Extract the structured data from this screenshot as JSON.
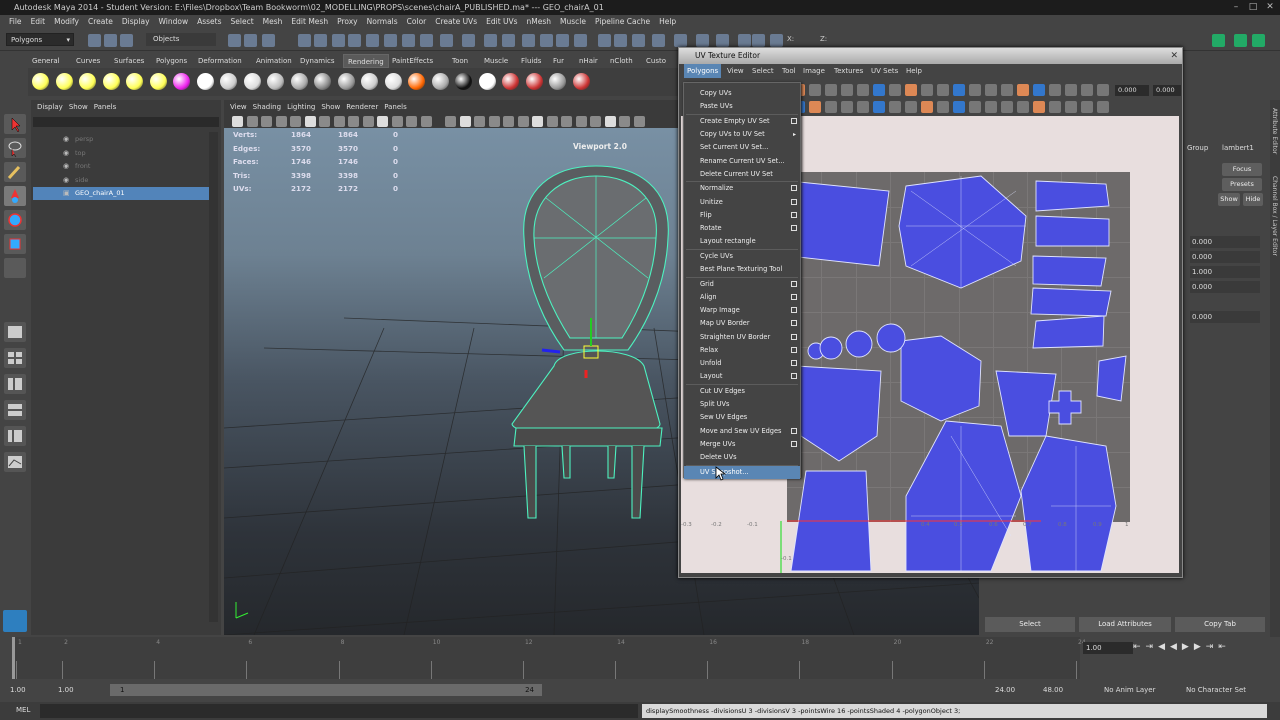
{
  "window": {
    "title": "Autodesk Maya 2014 - Student Version: E:\\Files\\Dropbox\\Team Bookworm\\02_MODELLING\\PROPS\\scenes\\chairA_PUBLISHED.ma*  ---  GEO_chairA_01"
  },
  "menu_bar": [
    "File",
    "Edit",
    "Modify",
    "Create",
    "Display",
    "Window",
    "Assets",
    "Select",
    "Mesh",
    "Edit Mesh",
    "Proxy",
    "Normals",
    "Color",
    "Create UVs",
    "Edit UVs",
    "nMesh",
    "Muscle",
    "Pipeline Cache",
    "Help"
  ],
  "status_line": {
    "mode": "Polygons",
    "objects_label": "Objects",
    "x_label": "X:",
    "y_label": "Y:",
    "z_label": "Z:"
  },
  "shelf": {
    "tabs": [
      "General",
      "Curves",
      "Surfaces",
      "Polygons",
      "Deformation",
      "Animation",
      "Dynamics",
      "Rendering",
      "PaintEffects",
      "Toon",
      "Muscle",
      "Fluids",
      "Fur",
      "nHair",
      "nCloth",
      "Custo"
    ],
    "active_tab": "Rendering"
  },
  "outliner": {
    "menu": [
      "Display",
      "Show",
      "Panels"
    ],
    "items": [
      "persp",
      "top",
      "front",
      "side",
      "GEO_chairA_01"
    ],
    "selected": "GEO_chairA_01"
  },
  "viewport": {
    "menu": [
      "View",
      "Shading",
      "Lighting",
      "Show",
      "Renderer",
      "Panels"
    ],
    "name": "Viewport 2.0",
    "hud": [
      {
        "label": "Verts:",
        "v1": "1864",
        "v2": "1864",
        "v3": "0"
      },
      {
        "label": "Edges:",
        "v1": "3570",
        "v2": "3570",
        "v3": "0"
      },
      {
        "label": "Faces:",
        "v1": "1746",
        "v2": "1746",
        "v3": "0"
      },
      {
        "label": "Tris:",
        "v1": "3398",
        "v2": "3398",
        "v3": "0"
      },
      {
        "label": "UVs:",
        "v1": "2172",
        "v2": "2172",
        "v3": "0"
      }
    ]
  },
  "uv_editor": {
    "title": "UV Texture Editor",
    "menu": [
      "Polygons",
      "View",
      "Select",
      "Tool",
      "Image",
      "Textures",
      "UV Sets",
      "Help"
    ],
    "active_menu": "Polygons",
    "field1": "0.000",
    "field2": "0.000",
    "axis_labels": [
      "-0.3",
      "-0.2",
      "-0.1",
      "0.4",
      "0.5",
      "0.6",
      "0.7",
      "0.8",
      "0.9",
      "1"
    ],
    "tick_bottom": "-0.1"
  },
  "dropdown": {
    "items": [
      {
        "label": "Copy UVs",
        "box": false
      },
      {
        "label": "Paste UVs",
        "box": false
      },
      {
        "label": "Create Empty UV Set",
        "box": true
      },
      {
        "label": "Copy UVs to UV Set",
        "arrow": true
      },
      {
        "label": "Set Current UV Set...",
        "box": false
      },
      {
        "label": "Rename Current UV Set...",
        "box": false
      },
      {
        "label": "Delete Current UV Set",
        "box": false
      },
      {
        "label": "Normalize",
        "box": true
      },
      {
        "label": "Unitize",
        "box": true
      },
      {
        "label": "Flip",
        "box": true
      },
      {
        "label": "Rotate",
        "box": true
      },
      {
        "label": "Layout rectangle",
        "box": false
      },
      {
        "label": "Cycle UVs",
        "box": false
      },
      {
        "label": "Best Plane Texturing Tool",
        "box": false
      },
      {
        "label": "Grid",
        "box": true
      },
      {
        "label": "Align",
        "box": true
      },
      {
        "label": "Warp Image",
        "box": true
      },
      {
        "label": "Map UV Border",
        "box": true
      },
      {
        "label": "Straighten UV Border",
        "box": true
      },
      {
        "label": "Relax",
        "box": true
      },
      {
        "label": "Unfold",
        "box": true
      },
      {
        "label": "Layout",
        "box": true
      },
      {
        "label": "Cut UV Edges",
        "box": false
      },
      {
        "label": "Split UVs",
        "box": false
      },
      {
        "label": "Sew UV Edges",
        "box": false
      },
      {
        "label": "Move and Sew UV Edges",
        "box": true
      },
      {
        "label": "Merge UVs",
        "box": true
      },
      {
        "label": "Delete UVs",
        "box": false
      },
      {
        "label": "UV Snapshot...",
        "box": false
      }
    ],
    "highlighted": "UV Snapshot..."
  },
  "channel_box": {
    "tabs": [
      "Group",
      "lambert1"
    ],
    "buttons": [
      "Focus",
      "Presets",
      "Show",
      "Hide"
    ],
    "values": [
      "0.000",
      "0.000",
      "1.000",
      "0.000",
      "0.000"
    ],
    "bottom_buttons": [
      "Select",
      "Load Attributes",
      "Copy Tab"
    ],
    "side_tabs": [
      "Attribute Editor",
      "Channel Box / Layer Editor"
    ]
  },
  "timeline": {
    "current_frame": "1.00",
    "ticks": [
      "1",
      "2",
      "4",
      "6",
      "8",
      "10",
      "12",
      "14",
      "16",
      "18",
      "20",
      "22",
      "24"
    ]
  },
  "range": {
    "start": "1.00",
    "inner_start": "1.00",
    "slider_start": "1",
    "slider_end": "24",
    "end": "24.00",
    "outer_end": "48.00",
    "anim_layer": "No Anim Layer",
    "char_set": "No Character Set"
  },
  "command_line": {
    "lang": "MEL",
    "feedback": "displaySmoothness -divisionsU 3 -divisionsV 3 -pointsWire 16 -pointsShaded 4 -polygonObject 3;"
  },
  "colors": {
    "accent": "#5a86b4",
    "wire": "#4df2c0",
    "uv_shell": "#4a4ee0"
  }
}
